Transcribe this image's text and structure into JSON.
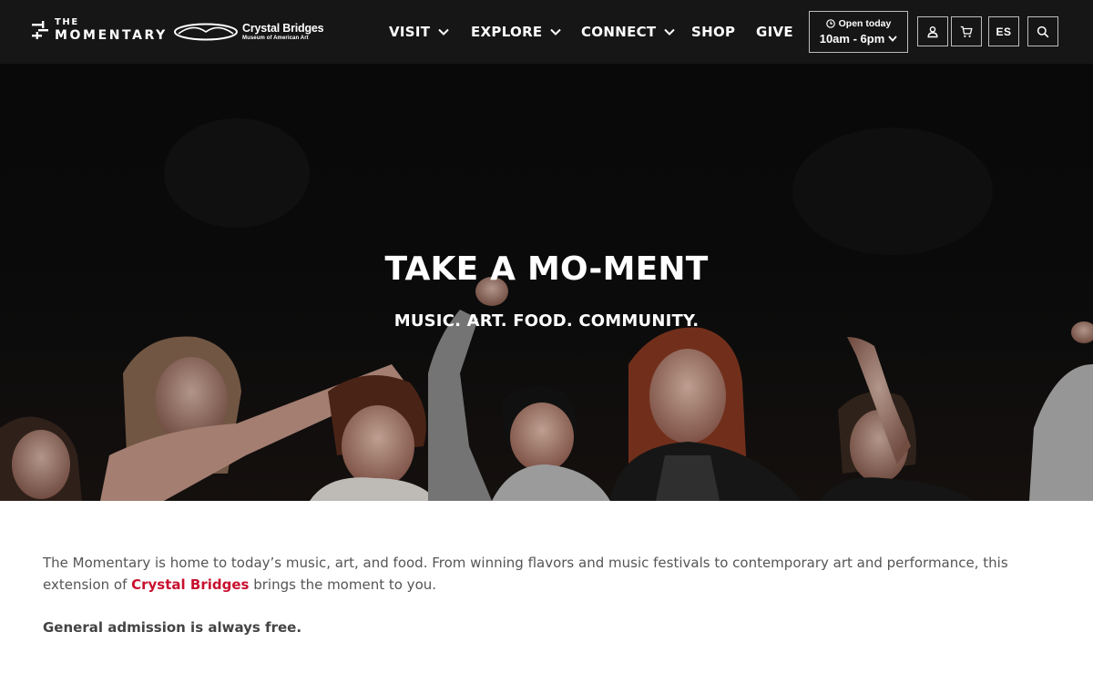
{
  "header": {
    "logo_momentary": {
      "line1": "THE",
      "line2": "MOMENTARY"
    },
    "logo_crystal_bridges": {
      "name": "Crystal Bridges",
      "sub": "Museum of American Art"
    },
    "nav": [
      {
        "label": "VISIT",
        "has_dropdown": true
      },
      {
        "label": "EXPLORE",
        "has_dropdown": true
      },
      {
        "label": "CONNECT",
        "has_dropdown": true
      },
      {
        "label": "SHOP",
        "has_dropdown": false
      },
      {
        "label": "GIVE",
        "has_dropdown": false
      }
    ],
    "hours": {
      "status": "Open today",
      "time": "10am - 6pm"
    },
    "icons": {
      "account": "user-icon",
      "cart": "cart-icon",
      "search": "search-icon",
      "clock": "clock-icon"
    },
    "language_label": "ES"
  },
  "hero": {
    "title": "TAKE A MO-MENT",
    "subtitle": "MUSIC. ART. FOOD. COMMUNITY."
  },
  "intro": {
    "text_before": "The Momentary is home to today’s music, art, and food. From winning flavors and music festivals to contemporary art and performance, this extension of ",
    "link_text": "Crystal Bridges",
    "text_after": " brings the moment to you.",
    "admission": "General admission is always free."
  },
  "colors": {
    "header_bg": "#161616",
    "link_red": "#c8102e",
    "body_text": "#555555"
  }
}
